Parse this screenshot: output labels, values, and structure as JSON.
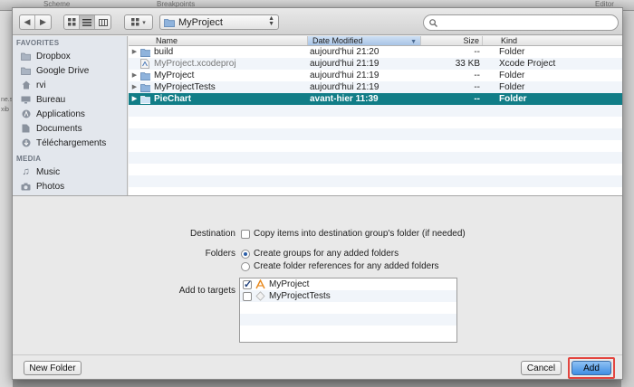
{
  "background": {
    "top_labels": [
      "Scheme",
      "Breakpoints",
      "Editor"
    ],
    "left_fragments": [
      "ne.s",
      "xib"
    ]
  },
  "toolbar": {
    "back_icon": "chevron-left-icon",
    "forward_icon": "chevron-right-icon",
    "view_modes": [
      "icon-view-icon",
      "list-view-icon",
      "column-view-icon"
    ],
    "arrange_icon": "grid-icon",
    "path_label": "MyProject",
    "search_placeholder": ""
  },
  "sidebar": {
    "favorites_header": "FAVORITES",
    "favorites": [
      {
        "label": "Dropbox",
        "icon": "folder-icon"
      },
      {
        "label": "Google Drive",
        "icon": "folder-icon"
      },
      {
        "label": "rvi",
        "icon": "home-icon"
      },
      {
        "label": "Bureau",
        "icon": "desktop-icon"
      },
      {
        "label": "Applications",
        "icon": "applications-icon"
      },
      {
        "label": "Documents",
        "icon": "documents-icon"
      },
      {
        "label": "Téléchargements",
        "icon": "downloads-icon"
      }
    ],
    "media_header": "MEDIA",
    "media": [
      {
        "label": "Music",
        "icon": "music-icon"
      },
      {
        "label": "Photos",
        "icon": "camera-icon"
      }
    ]
  },
  "file_list": {
    "columns": {
      "name": "Name",
      "date": "Date Modified",
      "size": "Size",
      "kind": "Kind"
    },
    "sorted_column": "Date Modified",
    "rows": [
      {
        "name": "build",
        "date": "aujourd'hui 21:20",
        "size": "--",
        "kind": "Folder",
        "type": "folder",
        "expandable": true,
        "selected": false
      },
      {
        "name": "MyProject.xcodeproj",
        "date": "aujourd'hui 21:19",
        "size": "33 KB",
        "kind": "Xcode Project",
        "type": "project",
        "expandable": false,
        "selected": false
      },
      {
        "name": "MyProject",
        "date": "aujourd'hui 21:19",
        "size": "--",
        "kind": "Folder",
        "type": "folder",
        "expandable": true,
        "selected": false
      },
      {
        "name": "MyProjectTests",
        "date": "aujourd'hui 21:19",
        "size": "--",
        "kind": "Folder",
        "type": "folder",
        "expandable": true,
        "selected": false
      },
      {
        "name": "PieChart",
        "date": "avant-hier 11:39",
        "size": "--",
        "kind": "Folder",
        "type": "folder",
        "expandable": true,
        "selected": true
      }
    ]
  },
  "options": {
    "destination_label": "Destination",
    "destination_checkbox": "Copy items into destination group's folder (if needed)",
    "destination_checked": false,
    "folders_label": "Folders",
    "folders_radio_1": "Create groups for any added folders",
    "folders_radio_2": "Create folder references for any added folders",
    "folders_selected": 1,
    "targets_label": "Add to targets",
    "targets": [
      {
        "label": "MyProject",
        "checked": true,
        "icon": "app-target-icon"
      },
      {
        "label": "MyProjectTests",
        "checked": false,
        "icon": "test-target-icon"
      }
    ]
  },
  "buttons": {
    "new_folder": "New Folder",
    "cancel": "Cancel",
    "add": "Add"
  },
  "colors": {
    "selection": "#117d87",
    "highlight": "#e3453f",
    "default_button": "#3f8ee3"
  }
}
